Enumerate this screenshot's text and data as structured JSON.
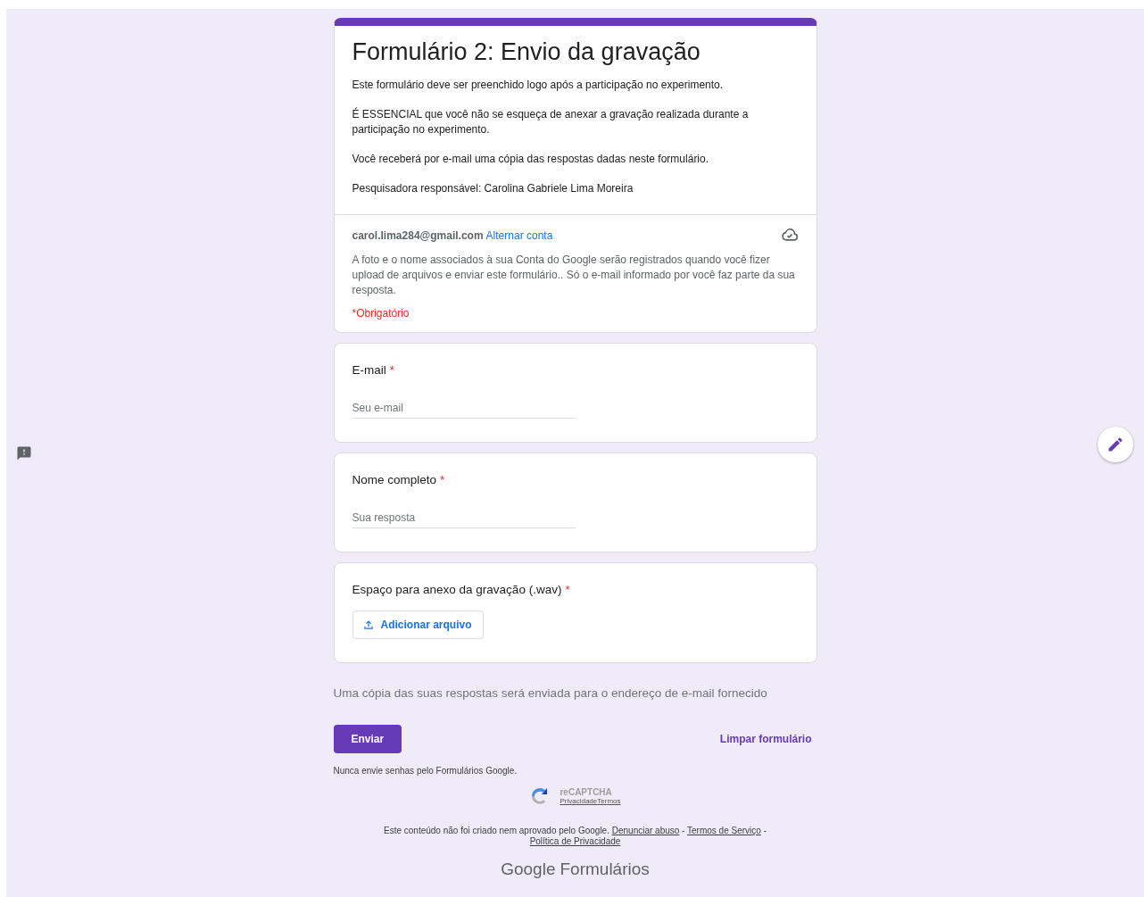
{
  "header": {
    "title": "Formulário 2: Envio da gravação",
    "paragraphs": [
      "Este formulário deve ser preenchido logo após a participação no experimento.",
      "É ESSENCIAL que você não se esqueça de anexar a gravação realizada durante a participação no experimento.",
      "Você receberá por e-mail uma cópia das respostas dadas neste formulário.",
      "Pesquisadora responsável: Carolina Gabriele Lima Moreira"
    ],
    "account": {
      "email": "carol.lima284@gmail.com",
      "switch_link": "Alternar conta",
      "notice": "A foto e o nome associados à sua Conta do Google serão registrados quando você fizer upload de arquivos e enviar este formulário.. Só o e-mail informado por você faz parte da sua resposta."
    },
    "required_note": "*Obrigatório"
  },
  "questions": [
    {
      "kind": "text",
      "label": "E-mail",
      "required_mark": "*",
      "placeholder": "Seu e-mail"
    },
    {
      "kind": "text",
      "label": "Nome completo",
      "required_mark": "*",
      "placeholder": "Sua resposta"
    },
    {
      "kind": "file",
      "label": "Espaço para anexo da gravação (.wav)",
      "required_mark": "*",
      "button": "Adicionar arquivo"
    }
  ],
  "copy_notice": "Uma cópia das suas respostas será enviada para o endereço de e-mail fornecido",
  "submit_button": "Enviar",
  "clear_button": "Limpar formulário",
  "password_warning": "Nunca envie senhas pelo Formulários Google.",
  "recaptcha": {
    "label": "reCAPTCHA",
    "privacy": "Privacidade",
    "terms": "Termos"
  },
  "disclaimer": {
    "text": "Este conteúdo não foi criado nem aprovado pelo Google.",
    "links": [
      "Denunciar abuso",
      "Termos de Serviço",
      "Política de Privacidade"
    ],
    "separator": "-"
  },
  "brand": {
    "google": "Google",
    "product": "Formulários"
  }
}
